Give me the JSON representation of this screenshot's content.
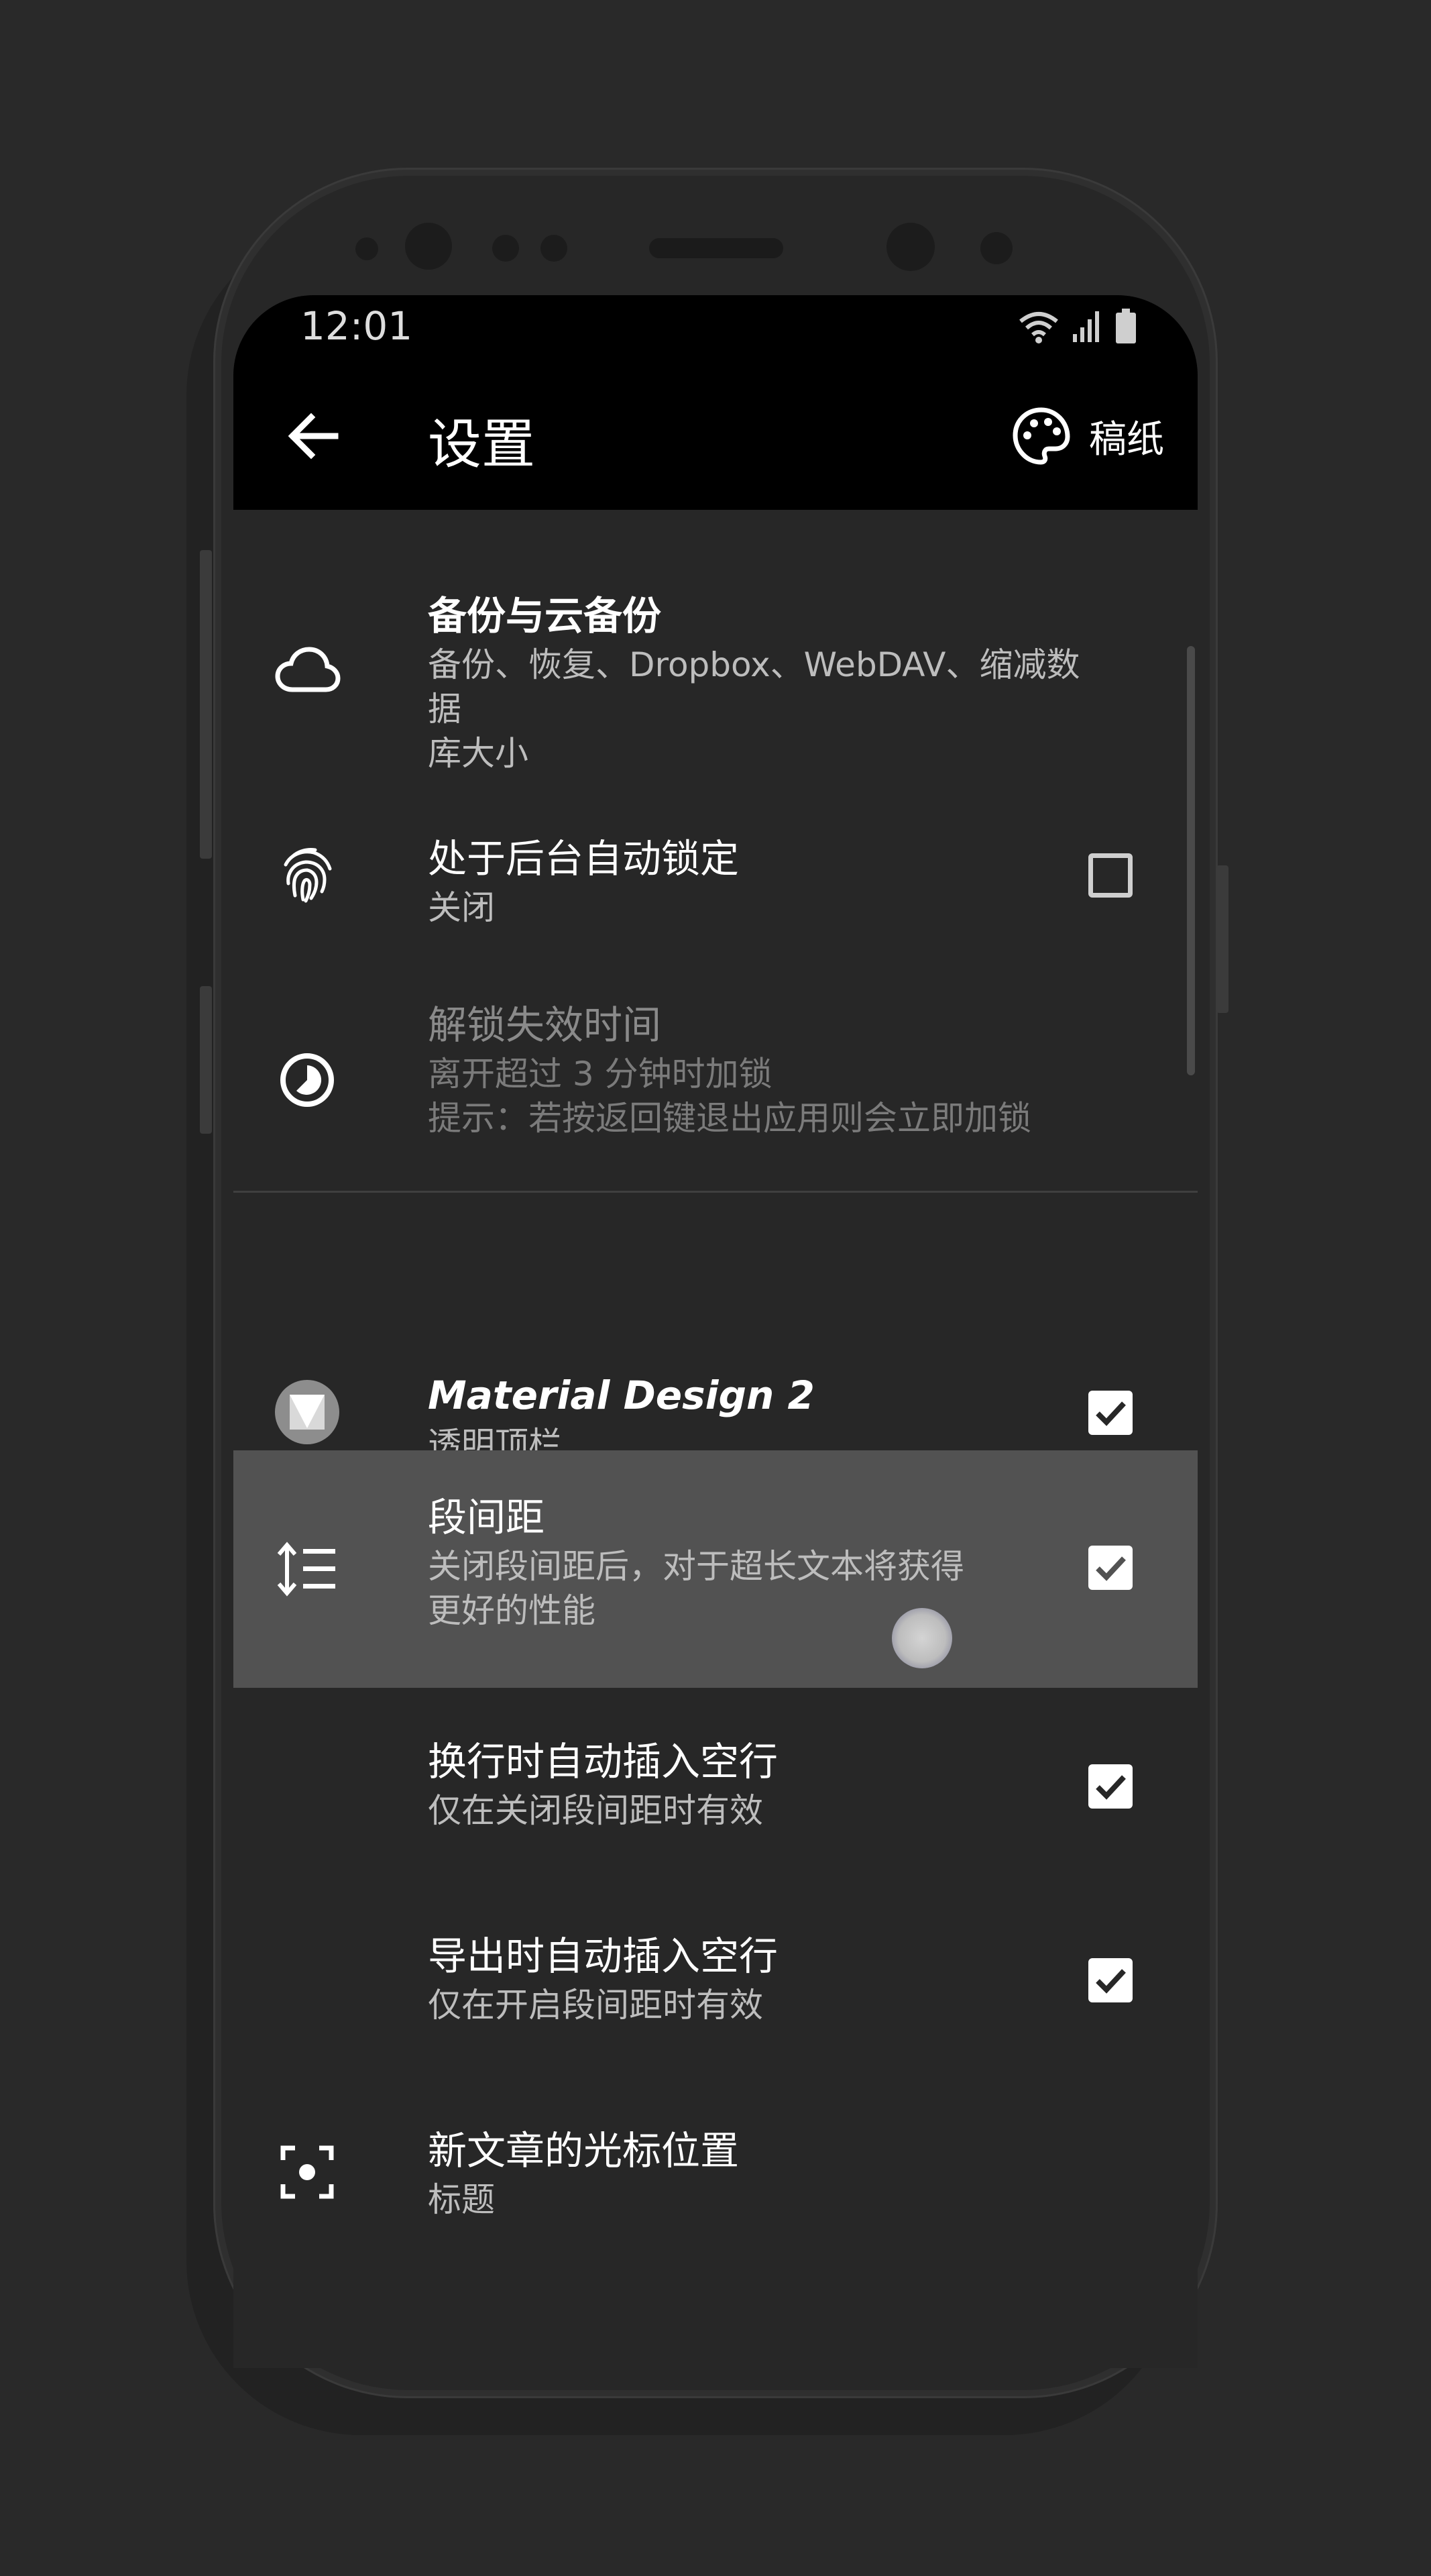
{
  "status_bar": {
    "time": "12:01",
    "icons": [
      "wifi-icon",
      "signal-icon",
      "battery-icon"
    ]
  },
  "app_bar": {
    "title": "设置",
    "back_icon": "arrow-left-icon",
    "theme_icon": "palette-icon",
    "theme_label": "稿纸"
  },
  "settings": [
    {
      "icon": "cloud-icon",
      "title": "备份与云备份",
      "subtitle_lines": [
        "备份、恢复、Dropbox、WebDAV、缩减数据",
        "库大小"
      ],
      "control": "none"
    },
    {
      "icon": "fingerprint-icon",
      "title": "处于后台自动锁定",
      "subtitle_lines": [
        "关闭"
      ],
      "control": "checkbox",
      "checked": false
    },
    {
      "icon": "timer-icon",
      "title": "解锁失效时间",
      "subtitle_lines": [
        "离开超过 3 分钟时加锁",
        "提示：若按返回键退出应用则会立即加锁"
      ],
      "control": "none",
      "disabled": true
    },
    {
      "icon": "material-design-icon",
      "title": "Material Design 2",
      "subtitle_lines": [
        "透明顶栏"
      ],
      "control": "checkbox",
      "checked": true
    },
    {
      "icon": "line-spacing-icon",
      "title": "段间距",
      "subtitle_lines": [
        "关闭段间距后，对于超长文本将获得",
        "更好的性能"
      ],
      "control": "checkbox",
      "checked": true,
      "highlighted": true
    },
    {
      "icon": "",
      "title": "换行时自动插入空行",
      "subtitle_lines": [
        "仅在关闭段间距时有效"
      ],
      "control": "checkbox",
      "checked": true
    },
    {
      "icon": "",
      "title": "导出时自动插入空行",
      "subtitle_lines": [
        "仅在开启段间距时有效"
      ],
      "control": "checkbox",
      "checked": true
    },
    {
      "icon": "cursor-position-icon",
      "title": "新文章的光标位置",
      "subtitle_lines": [
        "标题"
      ],
      "control": "none"
    }
  ],
  "colors": {
    "background": "#292929",
    "app_bar": "#000000",
    "highlight_row": "#525252",
    "text_primary": "#ffffff",
    "text_secondary": "#bdbdbd"
  }
}
